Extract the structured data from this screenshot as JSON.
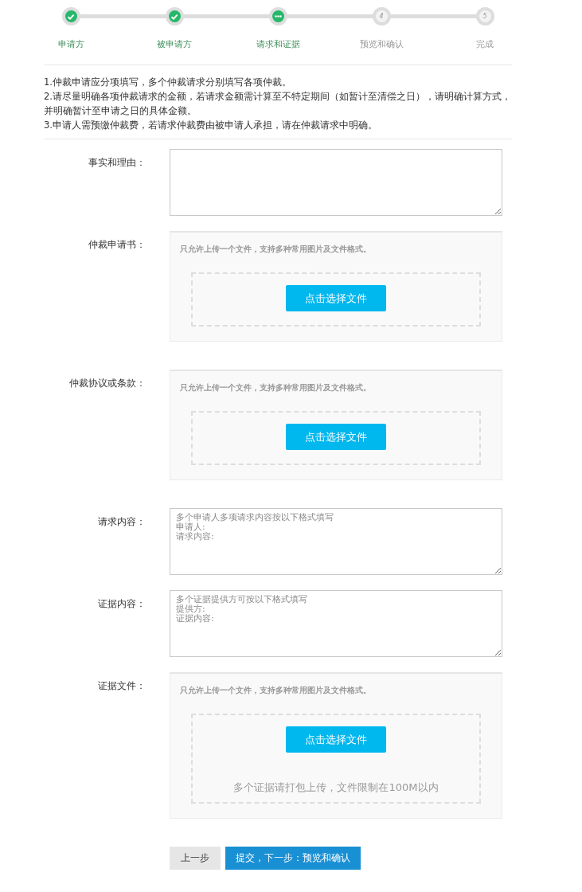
{
  "steps": [
    {
      "label": "申请方",
      "completed": true,
      "selected": false
    },
    {
      "label": "被申请方",
      "completed": true,
      "selected": false
    },
    {
      "label": "请求和证据",
      "completed": false,
      "selected": true
    },
    {
      "label": "预览和确认",
      "completed": false,
      "selected": false,
      "number": "4"
    },
    {
      "label": "完成",
      "completed": false,
      "selected": false,
      "number": "5"
    }
  ],
  "notes": [
    "1.仲裁申请应分项填写，多个仲裁请求分别填写各项仲裁。",
    "2.请尽量明确各项仲裁请求的金额，若请求金额需计算至不特定期间（如暂计至清偿之日），请明确计算方式，并明确暂计至申请之日的具体金额。",
    "3.申请人需预缴仲裁费，若请求仲裁费由被申请人承担，请在仲裁请求中明确。"
  ],
  "fields": [
    {
      "kind": "textarea",
      "label": "事实和理由："
    },
    {
      "kind": "upload",
      "label": "仲裁申请书：",
      "hint": "只允许上传一个文件，支持多种常用图片及文件格式。",
      "button": "点击选择文件"
    },
    {
      "kind": "upload",
      "label": "仲裁协议或条款：",
      "hint": "只允许上传一个文件，支持多种常用图片及文件格式。",
      "button": "点击选择文件"
    },
    {
      "kind": "textarea",
      "label": "请求内容：",
      "placeholder_lines": [
        "多个申请人多项请求内容按以下格式填写",
        "申请人:",
        "请求内容:"
      ]
    },
    {
      "kind": "textarea",
      "label": "证据内容：",
      "placeholder_lines": [
        "多个证据提供方可按以下格式填写",
        "提供方:",
        "证据内容:"
      ]
    },
    {
      "kind": "upload",
      "label": "证据文件：",
      "hint": "只允许上传一个文件，支持多种常用图片及文件格式。",
      "button": "点击选择文件",
      "note": "多个证据请打包上传，文件限制在100M以内"
    }
  ],
  "actions": {
    "back": "上一步",
    "submit": "提交，下一步：预览和确认"
  }
}
